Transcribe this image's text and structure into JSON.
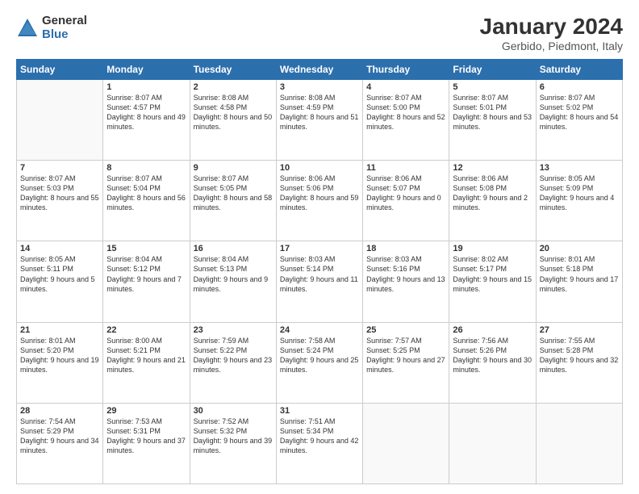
{
  "logo": {
    "general": "General",
    "blue": "Blue"
  },
  "title": "January 2024",
  "location": "Gerbido, Piedmont, Italy",
  "weekdays": [
    "Sunday",
    "Monday",
    "Tuesday",
    "Wednesday",
    "Thursday",
    "Friday",
    "Saturday"
  ],
  "weeks": [
    [
      {
        "day": "",
        "sunrise": "",
        "sunset": "",
        "daylight": ""
      },
      {
        "day": "1",
        "sunrise": "Sunrise: 8:07 AM",
        "sunset": "Sunset: 4:57 PM",
        "daylight": "Daylight: 8 hours and 49 minutes."
      },
      {
        "day": "2",
        "sunrise": "Sunrise: 8:08 AM",
        "sunset": "Sunset: 4:58 PM",
        "daylight": "Daylight: 8 hours and 50 minutes."
      },
      {
        "day": "3",
        "sunrise": "Sunrise: 8:08 AM",
        "sunset": "Sunset: 4:59 PM",
        "daylight": "Daylight: 8 hours and 51 minutes."
      },
      {
        "day": "4",
        "sunrise": "Sunrise: 8:07 AM",
        "sunset": "Sunset: 5:00 PM",
        "daylight": "Daylight: 8 hours and 52 minutes."
      },
      {
        "day": "5",
        "sunrise": "Sunrise: 8:07 AM",
        "sunset": "Sunset: 5:01 PM",
        "daylight": "Daylight: 8 hours and 53 minutes."
      },
      {
        "day": "6",
        "sunrise": "Sunrise: 8:07 AM",
        "sunset": "Sunset: 5:02 PM",
        "daylight": "Daylight: 8 hours and 54 minutes."
      }
    ],
    [
      {
        "day": "7",
        "sunrise": "Sunrise: 8:07 AM",
        "sunset": "Sunset: 5:03 PM",
        "daylight": "Daylight: 8 hours and 55 minutes."
      },
      {
        "day": "8",
        "sunrise": "Sunrise: 8:07 AM",
        "sunset": "Sunset: 5:04 PM",
        "daylight": "Daylight: 8 hours and 56 minutes."
      },
      {
        "day": "9",
        "sunrise": "Sunrise: 8:07 AM",
        "sunset": "Sunset: 5:05 PM",
        "daylight": "Daylight: 8 hours and 58 minutes."
      },
      {
        "day": "10",
        "sunrise": "Sunrise: 8:06 AM",
        "sunset": "Sunset: 5:06 PM",
        "daylight": "Daylight: 8 hours and 59 minutes."
      },
      {
        "day": "11",
        "sunrise": "Sunrise: 8:06 AM",
        "sunset": "Sunset: 5:07 PM",
        "daylight": "Daylight: 9 hours and 0 minutes."
      },
      {
        "day": "12",
        "sunrise": "Sunrise: 8:06 AM",
        "sunset": "Sunset: 5:08 PM",
        "daylight": "Daylight: 9 hours and 2 minutes."
      },
      {
        "day": "13",
        "sunrise": "Sunrise: 8:05 AM",
        "sunset": "Sunset: 5:09 PM",
        "daylight": "Daylight: 9 hours and 4 minutes."
      }
    ],
    [
      {
        "day": "14",
        "sunrise": "Sunrise: 8:05 AM",
        "sunset": "Sunset: 5:11 PM",
        "daylight": "Daylight: 9 hours and 5 minutes."
      },
      {
        "day": "15",
        "sunrise": "Sunrise: 8:04 AM",
        "sunset": "Sunset: 5:12 PM",
        "daylight": "Daylight: 9 hours and 7 minutes."
      },
      {
        "day": "16",
        "sunrise": "Sunrise: 8:04 AM",
        "sunset": "Sunset: 5:13 PM",
        "daylight": "Daylight: 9 hours and 9 minutes."
      },
      {
        "day": "17",
        "sunrise": "Sunrise: 8:03 AM",
        "sunset": "Sunset: 5:14 PM",
        "daylight": "Daylight: 9 hours and 11 minutes."
      },
      {
        "day": "18",
        "sunrise": "Sunrise: 8:03 AM",
        "sunset": "Sunset: 5:16 PM",
        "daylight": "Daylight: 9 hours and 13 minutes."
      },
      {
        "day": "19",
        "sunrise": "Sunrise: 8:02 AM",
        "sunset": "Sunset: 5:17 PM",
        "daylight": "Daylight: 9 hours and 15 minutes."
      },
      {
        "day": "20",
        "sunrise": "Sunrise: 8:01 AM",
        "sunset": "Sunset: 5:18 PM",
        "daylight": "Daylight: 9 hours and 17 minutes."
      }
    ],
    [
      {
        "day": "21",
        "sunrise": "Sunrise: 8:01 AM",
        "sunset": "Sunset: 5:20 PM",
        "daylight": "Daylight: 9 hours and 19 minutes."
      },
      {
        "day": "22",
        "sunrise": "Sunrise: 8:00 AM",
        "sunset": "Sunset: 5:21 PM",
        "daylight": "Daylight: 9 hours and 21 minutes."
      },
      {
        "day": "23",
        "sunrise": "Sunrise: 7:59 AM",
        "sunset": "Sunset: 5:22 PM",
        "daylight": "Daylight: 9 hours and 23 minutes."
      },
      {
        "day": "24",
        "sunrise": "Sunrise: 7:58 AM",
        "sunset": "Sunset: 5:24 PM",
        "daylight": "Daylight: 9 hours and 25 minutes."
      },
      {
        "day": "25",
        "sunrise": "Sunrise: 7:57 AM",
        "sunset": "Sunset: 5:25 PM",
        "daylight": "Daylight: 9 hours and 27 minutes."
      },
      {
        "day": "26",
        "sunrise": "Sunrise: 7:56 AM",
        "sunset": "Sunset: 5:26 PM",
        "daylight": "Daylight: 9 hours and 30 minutes."
      },
      {
        "day": "27",
        "sunrise": "Sunrise: 7:55 AM",
        "sunset": "Sunset: 5:28 PM",
        "daylight": "Daylight: 9 hours and 32 minutes."
      }
    ],
    [
      {
        "day": "28",
        "sunrise": "Sunrise: 7:54 AM",
        "sunset": "Sunset: 5:29 PM",
        "daylight": "Daylight: 9 hours and 34 minutes."
      },
      {
        "day": "29",
        "sunrise": "Sunrise: 7:53 AM",
        "sunset": "Sunset: 5:31 PM",
        "daylight": "Daylight: 9 hours and 37 minutes."
      },
      {
        "day": "30",
        "sunrise": "Sunrise: 7:52 AM",
        "sunset": "Sunset: 5:32 PM",
        "daylight": "Daylight: 9 hours and 39 minutes."
      },
      {
        "day": "31",
        "sunrise": "Sunrise: 7:51 AM",
        "sunset": "Sunset: 5:34 PM",
        "daylight": "Daylight: 9 hours and 42 minutes."
      },
      {
        "day": "",
        "sunrise": "",
        "sunset": "",
        "daylight": ""
      },
      {
        "day": "",
        "sunrise": "",
        "sunset": "",
        "daylight": ""
      },
      {
        "day": "",
        "sunrise": "",
        "sunset": "",
        "daylight": ""
      }
    ]
  ]
}
